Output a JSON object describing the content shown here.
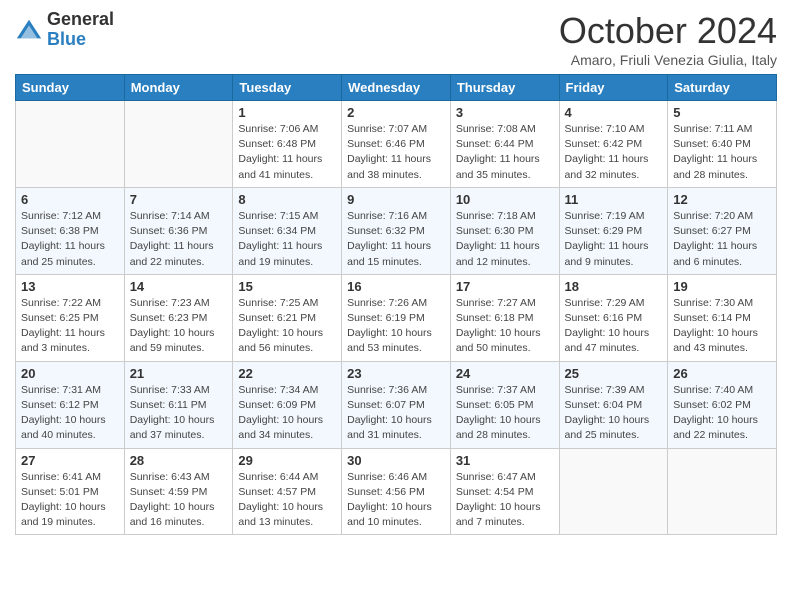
{
  "header": {
    "logo_general": "General",
    "logo_blue": "Blue",
    "month_title": "October 2024",
    "subtitle": "Amaro, Friuli Venezia Giulia, Italy"
  },
  "days_of_week": [
    "Sunday",
    "Monday",
    "Tuesday",
    "Wednesday",
    "Thursday",
    "Friday",
    "Saturday"
  ],
  "weeks": [
    [
      {
        "num": "",
        "info": ""
      },
      {
        "num": "",
        "info": ""
      },
      {
        "num": "1",
        "info": "Sunrise: 7:06 AM\nSunset: 6:48 PM\nDaylight: 11 hours and 41 minutes."
      },
      {
        "num": "2",
        "info": "Sunrise: 7:07 AM\nSunset: 6:46 PM\nDaylight: 11 hours and 38 minutes."
      },
      {
        "num": "3",
        "info": "Sunrise: 7:08 AM\nSunset: 6:44 PM\nDaylight: 11 hours and 35 minutes."
      },
      {
        "num": "4",
        "info": "Sunrise: 7:10 AM\nSunset: 6:42 PM\nDaylight: 11 hours and 32 minutes."
      },
      {
        "num": "5",
        "info": "Sunrise: 7:11 AM\nSunset: 6:40 PM\nDaylight: 11 hours and 28 minutes."
      }
    ],
    [
      {
        "num": "6",
        "info": "Sunrise: 7:12 AM\nSunset: 6:38 PM\nDaylight: 11 hours and 25 minutes."
      },
      {
        "num": "7",
        "info": "Sunrise: 7:14 AM\nSunset: 6:36 PM\nDaylight: 11 hours and 22 minutes."
      },
      {
        "num": "8",
        "info": "Sunrise: 7:15 AM\nSunset: 6:34 PM\nDaylight: 11 hours and 19 minutes."
      },
      {
        "num": "9",
        "info": "Sunrise: 7:16 AM\nSunset: 6:32 PM\nDaylight: 11 hours and 15 minutes."
      },
      {
        "num": "10",
        "info": "Sunrise: 7:18 AM\nSunset: 6:30 PM\nDaylight: 11 hours and 12 minutes."
      },
      {
        "num": "11",
        "info": "Sunrise: 7:19 AM\nSunset: 6:29 PM\nDaylight: 11 hours and 9 minutes."
      },
      {
        "num": "12",
        "info": "Sunrise: 7:20 AM\nSunset: 6:27 PM\nDaylight: 11 hours and 6 minutes."
      }
    ],
    [
      {
        "num": "13",
        "info": "Sunrise: 7:22 AM\nSunset: 6:25 PM\nDaylight: 11 hours and 3 minutes."
      },
      {
        "num": "14",
        "info": "Sunrise: 7:23 AM\nSunset: 6:23 PM\nDaylight: 10 hours and 59 minutes."
      },
      {
        "num": "15",
        "info": "Sunrise: 7:25 AM\nSunset: 6:21 PM\nDaylight: 10 hours and 56 minutes."
      },
      {
        "num": "16",
        "info": "Sunrise: 7:26 AM\nSunset: 6:19 PM\nDaylight: 10 hours and 53 minutes."
      },
      {
        "num": "17",
        "info": "Sunrise: 7:27 AM\nSunset: 6:18 PM\nDaylight: 10 hours and 50 minutes."
      },
      {
        "num": "18",
        "info": "Sunrise: 7:29 AM\nSunset: 6:16 PM\nDaylight: 10 hours and 47 minutes."
      },
      {
        "num": "19",
        "info": "Sunrise: 7:30 AM\nSunset: 6:14 PM\nDaylight: 10 hours and 43 minutes."
      }
    ],
    [
      {
        "num": "20",
        "info": "Sunrise: 7:31 AM\nSunset: 6:12 PM\nDaylight: 10 hours and 40 minutes."
      },
      {
        "num": "21",
        "info": "Sunrise: 7:33 AM\nSunset: 6:11 PM\nDaylight: 10 hours and 37 minutes."
      },
      {
        "num": "22",
        "info": "Sunrise: 7:34 AM\nSunset: 6:09 PM\nDaylight: 10 hours and 34 minutes."
      },
      {
        "num": "23",
        "info": "Sunrise: 7:36 AM\nSunset: 6:07 PM\nDaylight: 10 hours and 31 minutes."
      },
      {
        "num": "24",
        "info": "Sunrise: 7:37 AM\nSunset: 6:05 PM\nDaylight: 10 hours and 28 minutes."
      },
      {
        "num": "25",
        "info": "Sunrise: 7:39 AM\nSunset: 6:04 PM\nDaylight: 10 hours and 25 minutes."
      },
      {
        "num": "26",
        "info": "Sunrise: 7:40 AM\nSunset: 6:02 PM\nDaylight: 10 hours and 22 minutes."
      }
    ],
    [
      {
        "num": "27",
        "info": "Sunrise: 6:41 AM\nSunset: 5:01 PM\nDaylight: 10 hours and 19 minutes."
      },
      {
        "num": "28",
        "info": "Sunrise: 6:43 AM\nSunset: 4:59 PM\nDaylight: 10 hours and 16 minutes."
      },
      {
        "num": "29",
        "info": "Sunrise: 6:44 AM\nSunset: 4:57 PM\nDaylight: 10 hours and 13 minutes."
      },
      {
        "num": "30",
        "info": "Sunrise: 6:46 AM\nSunset: 4:56 PM\nDaylight: 10 hours and 10 minutes."
      },
      {
        "num": "31",
        "info": "Sunrise: 6:47 AM\nSunset: 4:54 PM\nDaylight: 10 hours and 7 minutes."
      },
      {
        "num": "",
        "info": ""
      },
      {
        "num": "",
        "info": ""
      }
    ]
  ]
}
